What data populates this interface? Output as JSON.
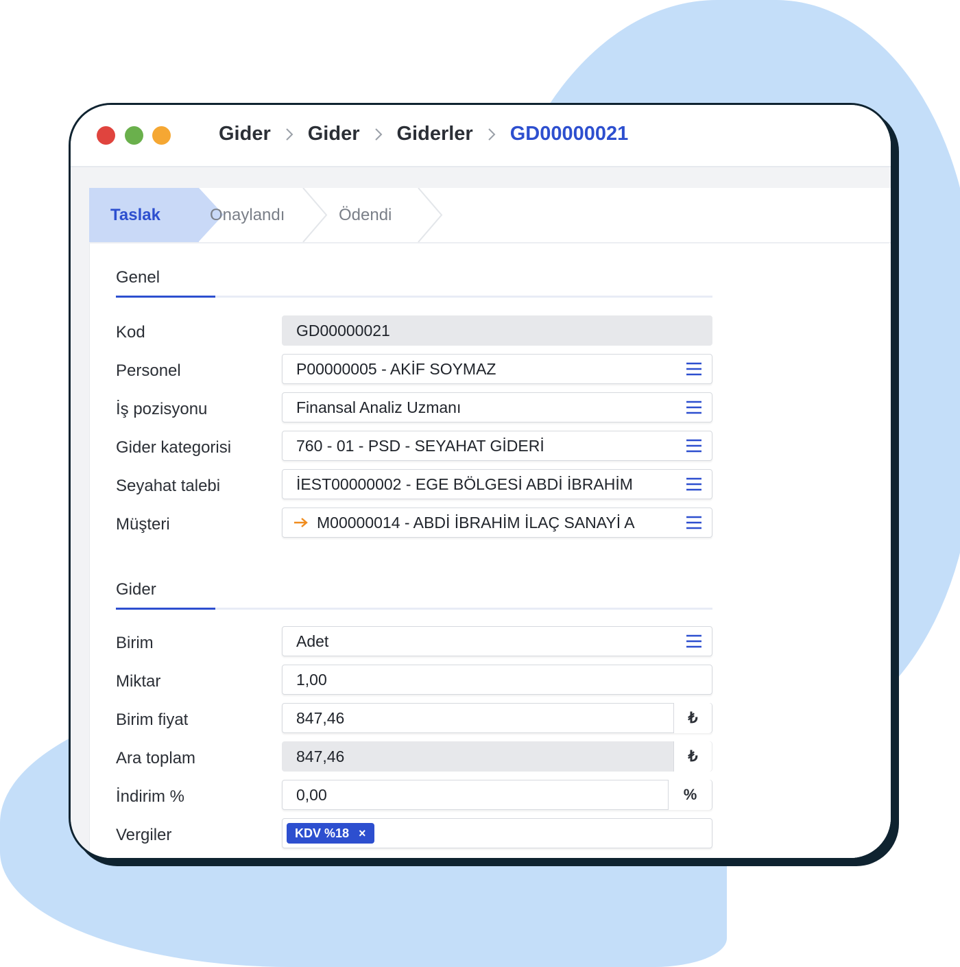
{
  "breadcrumb": {
    "items": [
      "Gider",
      "Gider",
      "Giderler"
    ],
    "current": "GD00000021"
  },
  "status_steps": {
    "active": "Taslak",
    "items": [
      "Onaylandı",
      "Ödendi"
    ]
  },
  "sections": {
    "genel": "Genel",
    "gider": "Gider"
  },
  "form": {
    "kod": {
      "label": "Kod",
      "value": "GD00000021"
    },
    "personel": {
      "label": "Personel",
      "value": "P00000005 - AKİF SOYMAZ"
    },
    "is_pozisyonu": {
      "label": "İş pozisyonu",
      "value": "Finansal Analiz Uzmanı"
    },
    "gider_kategorisi": {
      "label": "Gider kategorisi",
      "value": "760 - 01 - PSD - SEYAHAT GİDERİ"
    },
    "seyahat_talebi": {
      "label": "Seyahat talebi",
      "value": "İEST00000002 - EGE BÖLGESİ ABDİ İBRAHİM"
    },
    "musteri": {
      "label": "Müşteri",
      "value": "M00000014 - ABDİ İBRAHİM İLAÇ SANAYİ A"
    },
    "birim": {
      "label": "Birim",
      "value": "Adet"
    },
    "miktar": {
      "label": "Miktar",
      "value": "1,00"
    },
    "birim_fiyat": {
      "label": "Birim fiyat",
      "value": "847,46",
      "unit": "₺"
    },
    "ara_toplam": {
      "label": "Ara toplam",
      "value": "847,46",
      "unit": "₺"
    },
    "indirim": {
      "label": "İndirim %",
      "value": "0,00",
      "unit": "%"
    },
    "vergiler": {
      "label": "Vergiler",
      "tag": "KDV %18",
      "tag_remove": "×"
    }
  },
  "colors": {
    "accent": "#2d4fcf",
    "background_blob": "#c4def9",
    "link_arrow": "#f08c1e"
  },
  "icons": [
    "menu-icon",
    "arrow-right-icon",
    "chevron-right-icon",
    "close-icon"
  ]
}
